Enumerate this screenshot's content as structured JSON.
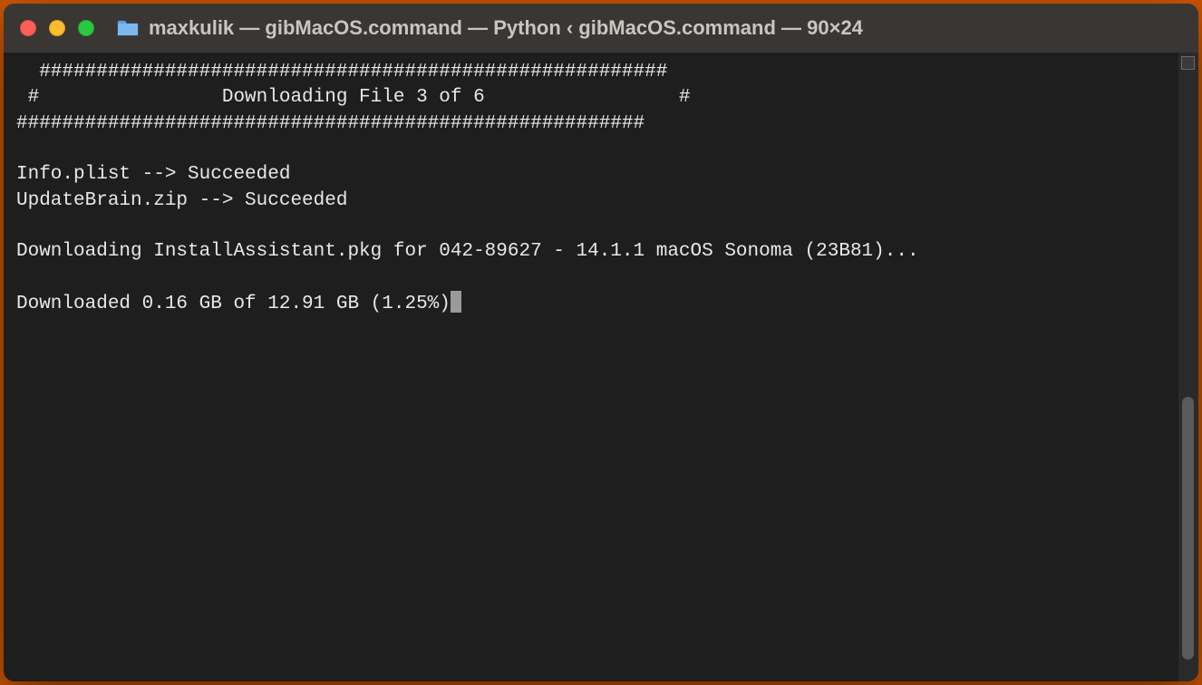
{
  "window": {
    "title": "maxkulik — gibMacOS.command — Python ‹ gibMacOS.command — 90×24",
    "folder_icon_name": "folder-icon"
  },
  "terminal": {
    "lines": [
      "  #######################################################",
      " #                Downloading File 3 of 6                 #",
      "#######################################################",
      "",
      "Info.plist --> Succeeded",
      "UpdateBrain.zip --> Succeeded",
      "",
      "Downloading InstallAssistant.pkg for 042-89627 - 14.1.1 macOS Sonoma (23B81)...",
      "",
      "Downloaded 0.16 GB of 12.91 GB (1.25%)"
    ]
  }
}
